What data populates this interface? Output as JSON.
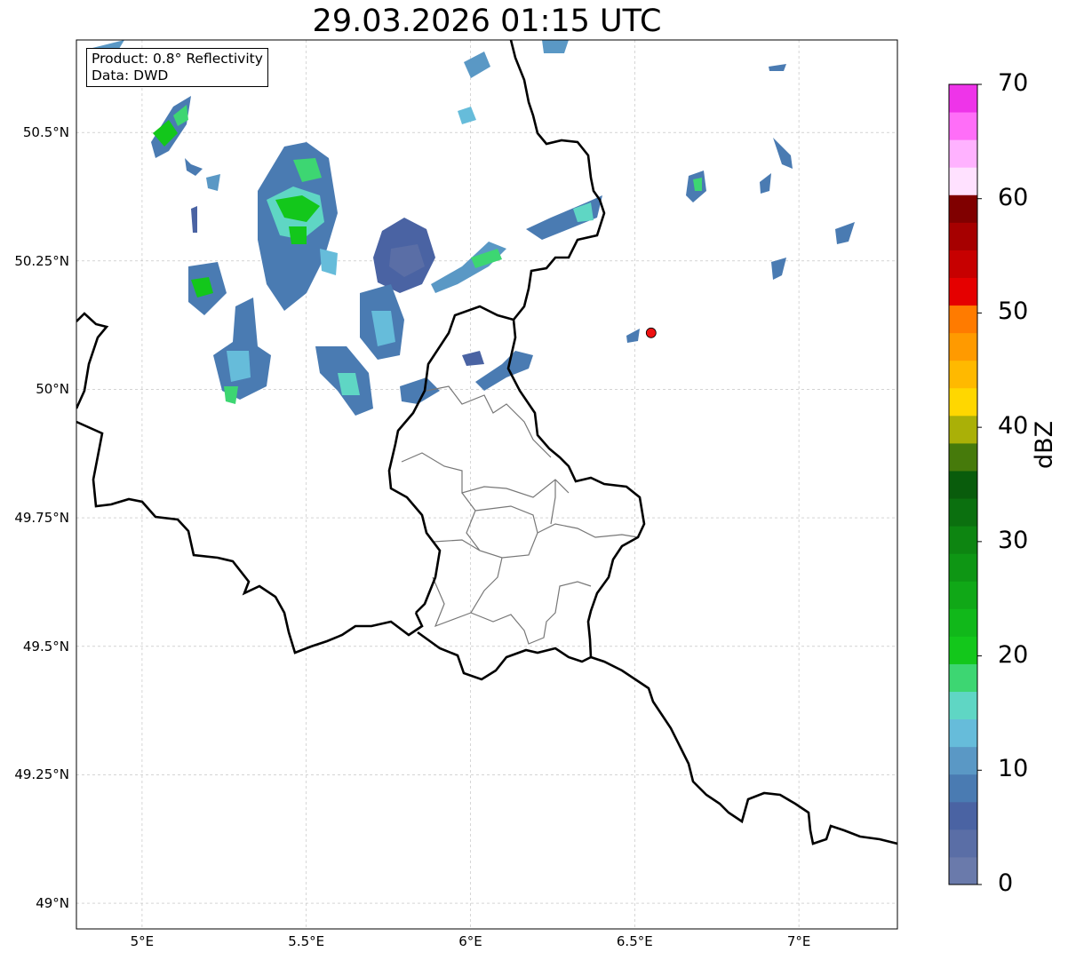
{
  "title": "29.03.2026 01:15 UTC",
  "info": {
    "product": "Product: 0.8° Reflectivity",
    "data": "Data: DWD"
  },
  "axes": {
    "lon_ticks": [
      "5°E",
      "5.5°E",
      "6°E",
      "6.5°E",
      "7°E"
    ],
    "lat_ticks": [
      "50.5°N",
      "50.25°N",
      "50°N",
      "49.75°N",
      "49.5°N",
      "49.25°N",
      "49°N"
    ],
    "lon_range": [
      4.8,
      7.3
    ],
    "lat_range": [
      48.95,
      50.68
    ],
    "grid": true
  },
  "marker": {
    "name": "radar-site",
    "lon": 6.55,
    "lat": 50.11,
    "color": "#ee1111"
  },
  "colorbar": {
    "label": "dBZ",
    "ticks": [
      "0",
      "10",
      "20",
      "30",
      "40",
      "50",
      "60",
      "70"
    ],
    "range": [
      0,
      70
    ],
    "step": 2.5,
    "colors": [
      "#6a7aab",
      "#5a6ea6",
      "#4a63a3",
      "#4a7bb2",
      "#5a98c5",
      "#66bcda",
      "#5fd6c4",
      "#3dd672",
      "#13c71b",
      "#11b81a",
      "#10a817",
      "#0e9614",
      "#0d8511",
      "#0b700f",
      "#095c0c",
      "#467a0b",
      "#aab007",
      "#ffd700",
      "#ffb900",
      "#ff9a00",
      "#ff7b00",
      "#e50000",
      "#c70000",
      "#a60000",
      "#800000",
      "#ffe1ff",
      "#ffb2ff",
      "#ff6ef8",
      "#ee34e9"
    ]
  },
  "colors": {
    "border_national": "#000000",
    "border_regional": "#777777",
    "grid": "#bbbbbb"
  }
}
